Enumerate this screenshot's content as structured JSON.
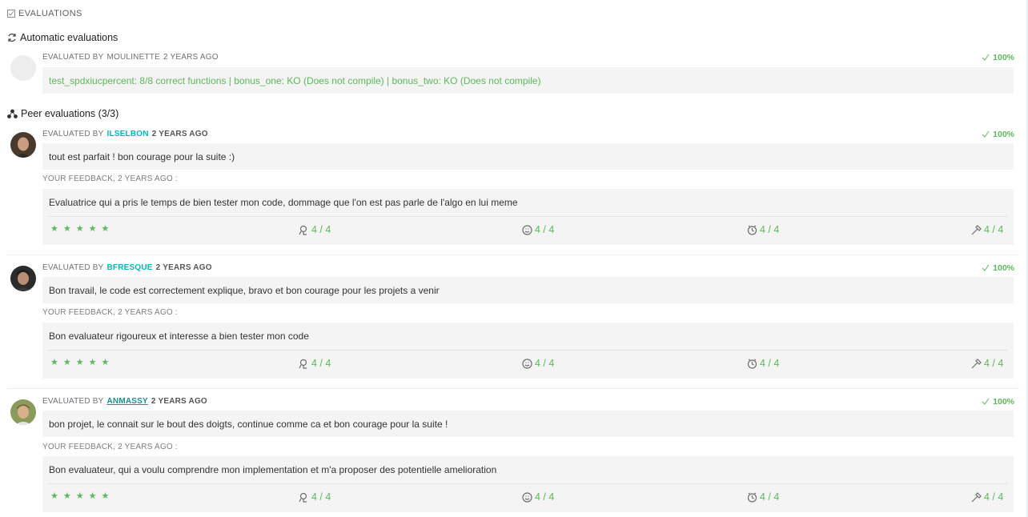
{
  "header": {
    "title": "EVALUATIONS"
  },
  "automatic": {
    "heading": "Automatic evaluations",
    "evaluated_by_prefix": "EVALUATED BY",
    "evaluator": "MOULINETTE",
    "ago": "2 YEARS AGO",
    "score": "100%",
    "result": "test_spdxiucpercent: 8/8 correct functions | bonus_one: KO (Does not compile) | bonus_two: KO (Does not compile)"
  },
  "peer": {
    "heading": "Peer evaluations (3/3)",
    "evaluations": [
      {
        "evaluated_by_prefix": "EVALUATED BY",
        "login": "ILSELBON",
        "ago": "2 YEARS AGO",
        "score": "100%",
        "comment": "tout est parfait ! bon courage pour la suite :)",
        "feedback_label": "YOUR FEEDBACK, 2 YEARS AGO :",
        "feedback": "Evaluatrice qui a pris le temps de bien tester mon code, dommage que l'on est pas parle de l'algo en lui meme",
        "stars": 5,
        "ratings": [
          "4 / 4",
          "4 / 4",
          "4 / 4",
          "4 / 4"
        ]
      },
      {
        "evaluated_by_prefix": "EVALUATED BY",
        "login": "BFRESQUE",
        "ago": "2 YEARS AGO",
        "score": "100%",
        "comment": "Bon travail, le code est correctement explique, bravo et bon courage pour les projets a venir",
        "feedback_label": "YOUR FEEDBACK, 2 YEARS AGO :",
        "feedback": "Bon evaluateur rigoureux et interesse a bien tester mon code",
        "stars": 5,
        "ratings": [
          "4 / 4",
          "4 / 4",
          "4 / 4",
          "4 / 4"
        ]
      },
      {
        "evaluated_by_prefix": "EVALUATED BY",
        "login": "ANMASSY",
        "ago": "2 YEARS AGO",
        "score": "100%",
        "comment": "bon projet, le connait sur le bout des doigts, continue comme ca et bon courage pour la suite !",
        "feedback_label": "YOUR FEEDBACK, 2 YEARS AGO :",
        "feedback": "Bon evaluateur, qui a voulu comprendre mon implementation et m'a proposer des potentielle amelioration",
        "stars": 5,
        "ratings": [
          "4 / 4",
          "4 / 4",
          "4 / 4",
          "4 / 4"
        ]
      }
    ]
  },
  "icons": {
    "header": "checkbox-icon",
    "automatic": "refresh-icon",
    "peer": "peers-icon",
    "score": "check-icon",
    "ratings": [
      "interest-icon",
      "smiley-icon",
      "clock-icon",
      "hammer-icon"
    ]
  },
  "colors": {
    "success": "#5cb85c",
    "login": "#00babc",
    "box_bg": "#f4f4f4"
  }
}
